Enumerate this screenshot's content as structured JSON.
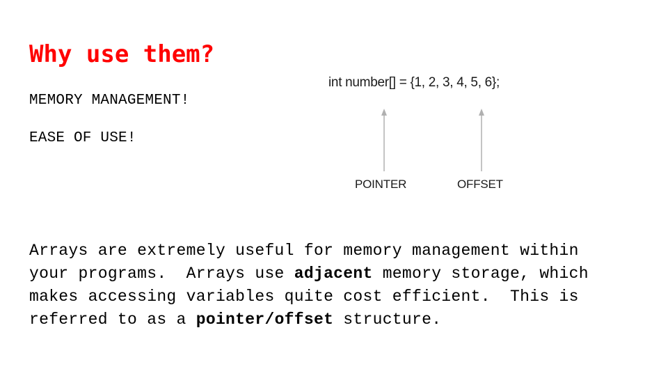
{
  "slide": {
    "title": "Why use them?",
    "bullets": [
      "MEMORY MANAGEMENT!",
      "EASE OF USE!"
    ],
    "diagram": {
      "code": "int number[] = {1, 2, 3, 4, 5, 6};",
      "labels": [
        "POINTER",
        "OFFSET"
      ],
      "arrow_color": "#b0b0b0"
    },
    "paragraph": {
      "line1": "Arrays are extremely useful for memory management within",
      "line2_a": "your programs.  Arrays use ",
      "line2_bold": "adjacent",
      "line2_b": " memory storage, which",
      "line3": "makes accessing variables quite cost efficient.  This is",
      "line4_a": "referred to as a ",
      "line4_bold": "pointer/offset",
      "line4_b": " structure."
    },
    "colors": {
      "title": "#ff0000",
      "text": "#000000",
      "background": "#ffffff"
    }
  }
}
